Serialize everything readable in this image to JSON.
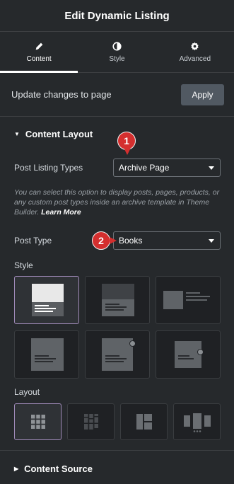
{
  "header": {
    "title": "Edit Dynamic Listing"
  },
  "tabs": [
    {
      "label": "Content",
      "icon": "pencil-icon",
      "active": true
    },
    {
      "label": "Style",
      "icon": "half-circle-icon",
      "active": false
    },
    {
      "label": "Advanced",
      "icon": "gear-icon",
      "active": false
    }
  ],
  "update": {
    "text": "Update changes to page",
    "apply_label": "Apply"
  },
  "content_layout": {
    "title": "Content Layout",
    "post_listing_types": {
      "label": "Post Listing Types",
      "value": "Archive Page"
    },
    "description": "You can select this option to display posts, pages, products, or any custom post types inside an archive template in Theme Builder.",
    "learn_more": "Learn More",
    "post_type": {
      "label": "Post Type",
      "value": "Books"
    },
    "style_label": "Style",
    "style_options": [
      "style-1",
      "style-2",
      "style-3",
      "style-4",
      "style-5",
      "style-6"
    ],
    "selected_style": 0,
    "layout_label": "Layout",
    "layout_options": [
      "grid",
      "masonry",
      "metro",
      "carousel"
    ],
    "selected_layout": 0
  },
  "content_source": {
    "title": "Content Source"
  },
  "markers": {
    "one": "1",
    "two": "2"
  },
  "colors": {
    "background": "#26292c",
    "selected_border": "#9f8ab8",
    "marker": "#d42f2f",
    "apply_bg": "#515962"
  }
}
